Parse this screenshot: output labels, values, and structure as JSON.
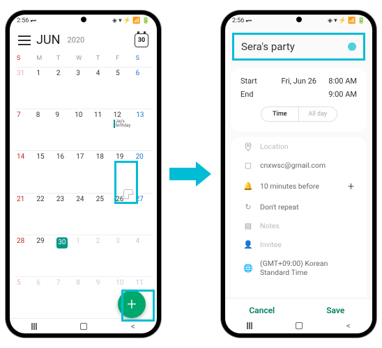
{
  "status": {
    "time": "2:56",
    "day_icon": "30"
  },
  "calendar": {
    "month": "JUN",
    "year": "2020",
    "today_icon_day": "30",
    "day_headers": [
      "S",
      "M",
      "T",
      "W",
      "T",
      "F",
      "S"
    ],
    "weeks": [
      [
        {
          "n": "31",
          "cls": "other sun"
        },
        {
          "n": "1",
          "cls": ""
        },
        {
          "n": "2",
          "cls": ""
        },
        {
          "n": "3",
          "cls": ""
        },
        {
          "n": "4",
          "cls": ""
        },
        {
          "n": "5",
          "cls": ""
        },
        {
          "n": "6",
          "cls": "sat"
        }
      ],
      [
        {
          "n": "7",
          "cls": "sun"
        },
        {
          "n": "8",
          "cls": ""
        },
        {
          "n": "9",
          "cls": ""
        },
        {
          "n": "10",
          "cls": ""
        },
        {
          "n": "11",
          "cls": ""
        },
        {
          "n": "12",
          "cls": "",
          "event": "Jay's birthday"
        },
        {
          "n": "13",
          "cls": "sat"
        }
      ],
      [
        {
          "n": "14",
          "cls": "sun"
        },
        {
          "n": "15",
          "cls": ""
        },
        {
          "n": "16",
          "cls": ""
        },
        {
          "n": "17",
          "cls": ""
        },
        {
          "n": "18",
          "cls": ""
        },
        {
          "n": "19",
          "cls": ""
        },
        {
          "n": "20",
          "cls": "sat"
        }
      ],
      [
        {
          "n": "21",
          "cls": "sun"
        },
        {
          "n": "22",
          "cls": ""
        },
        {
          "n": "23",
          "cls": ""
        },
        {
          "n": "24",
          "cls": ""
        },
        {
          "n": "25",
          "cls": ""
        },
        {
          "n": "26",
          "cls": "",
          "selected": true
        },
        {
          "n": "27",
          "cls": "sat"
        }
      ],
      [
        {
          "n": "28",
          "cls": "sun"
        },
        {
          "n": "29",
          "cls": ""
        },
        {
          "n": "30",
          "cls": "",
          "today": true
        },
        {
          "n": "1",
          "cls": "other"
        },
        {
          "n": "2",
          "cls": "other"
        },
        {
          "n": "3",
          "cls": "other"
        },
        {
          "n": "4",
          "cls": "other sat"
        }
      ],
      [
        {
          "n": "5",
          "cls": "other sun"
        },
        {
          "n": "6",
          "cls": "other"
        },
        {
          "n": "7",
          "cls": "other"
        },
        {
          "n": "8",
          "cls": "other"
        },
        {
          "n": "9",
          "cls": "other"
        },
        {
          "n": "10",
          "cls": "other"
        },
        {
          "n": "11",
          "cls": "other sat"
        }
      ]
    ],
    "fab_label": "+"
  },
  "event": {
    "title": "Sera's party",
    "start_label": "Start",
    "start_date": "Fri, Jun 26",
    "start_time": "8:00 AM",
    "end_label": "End",
    "end_date": "",
    "end_time": "9:00 AM",
    "toggle_time": "Time",
    "toggle_allday": "All day",
    "location_placeholder": "Location",
    "calendar_account": "cnxwsc@gmail.com",
    "reminder": "10 minutes before",
    "repeat": "Don't repeat",
    "notes": "Notes",
    "invitee": "Invitee",
    "timezone": "(GMT+09:00) Korean Standard Time",
    "cancel": "Cancel",
    "save": "Save"
  }
}
